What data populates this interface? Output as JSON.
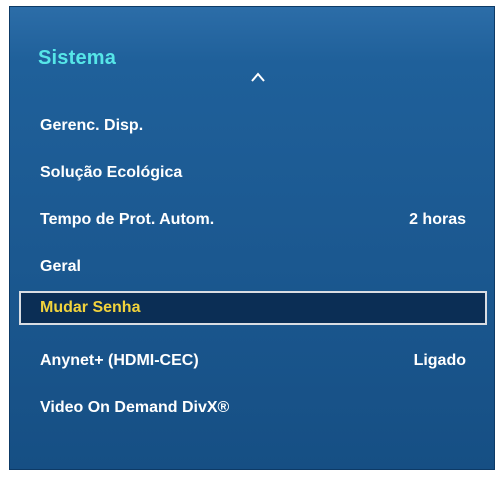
{
  "panel": {
    "title": "Sistema",
    "scroll_icon": "chevron-up-icon"
  },
  "menu": {
    "items": [
      {
        "label": "Gerenc. Disp.",
        "value": ""
      },
      {
        "label": "Solução Ecológica",
        "value": ""
      },
      {
        "label": "Tempo de Prot. Autom.",
        "value": "2 horas"
      },
      {
        "label": "Geral",
        "value": ""
      },
      {
        "label": "Mudar Senha",
        "value": "",
        "selected": true
      },
      {
        "label": "Anynet+ (HDMI-CEC)",
        "value": "Ligado"
      },
      {
        "label": "Video On Demand DivX®",
        "value": ""
      }
    ]
  },
  "colors": {
    "background": "#1b5890",
    "title": "#56e6e8",
    "text": "#ffffff",
    "selected_text": "#f2d33c",
    "selected_bg": "#0b2e55",
    "selected_border": "#d9dde3"
  }
}
